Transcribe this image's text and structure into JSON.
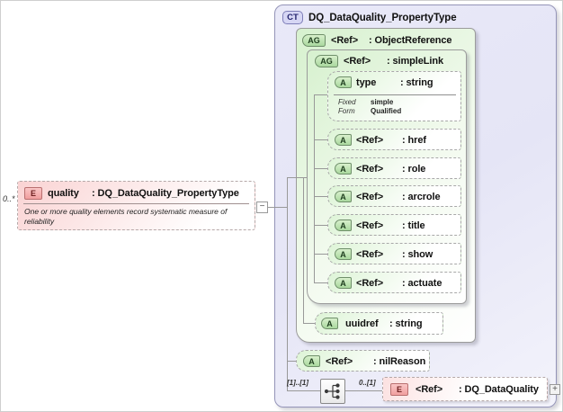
{
  "colors": {
    "line": "#999999",
    "ct-border": "#9494b8",
    "ct-badge-fill": "#d6d6f4",
    "ct-badge-border": "#7e7eb8",
    "ct-badge-text": "#24246e",
    "group-fill-a": "#d7f1cf",
    "group-border": "#9b9b9b",
    "capsule-border": "#a8a8a8",
    "capsule-fill": "#ddf4d6",
    "badge-green-a": "#d8f0cc",
    "badge-green-b": "#a9d89e",
    "badge-green-border": "#6f8f6a",
    "badge-green-text": "#1e3d1e",
    "e-badge-border": "#b97070",
    "e-badge-text": "#6e1f1f",
    "pink-fill-a": "#fad3d3"
  },
  "element": {
    "cardinality": "0..*",
    "badge": "E",
    "name": "quality",
    "type": ": DQ_DataQuality_PropertyType",
    "annotation": "One or more quality elements record systematic measure of reliability",
    "collapse": "−"
  },
  "complex_type": {
    "badge": "CT",
    "title": "DQ_DataQuality_PropertyType",
    "object_reference": {
      "badge": "AG",
      "name": "<Ref>",
      "type": ": ObjectReference"
    },
    "simple_link": {
      "badge": "AG",
      "name": "<Ref>",
      "type": ": simpleLink"
    },
    "type_attribute": {
      "badge": "A",
      "name": "type",
      "type": ": string",
      "facets": [
        {
          "label": "Fixed",
          "value": "simple"
        },
        {
          "label": "Form",
          "value": "Qualified"
        }
      ]
    },
    "attributes": [
      {
        "badge": "A",
        "name": "<Ref>",
        "type": ": href"
      },
      {
        "badge": "A",
        "name": "<Ref>",
        "type": ": role"
      },
      {
        "badge": "A",
        "name": "<Ref>",
        "type": ": arcrole"
      },
      {
        "badge": "A",
        "name": "<Ref>",
        "type": ": title"
      },
      {
        "badge": "A",
        "name": "<Ref>",
        "type": ": show"
      },
      {
        "badge": "A",
        "name": "<Ref>",
        "type": ": actuate"
      }
    ],
    "uuidref": {
      "badge": "A",
      "name": "uuidref",
      "type": ": string"
    },
    "nil_reason": {
      "badge": "A",
      "name": "<Ref>",
      "type": ": nilReason"
    },
    "choice": {
      "left_cardinality": "[1]..[1]",
      "right_cardinality": "0..[1]"
    },
    "dq_element": {
      "badge": "E",
      "name": "<Ref>",
      "type": ": DQ_DataQuality",
      "expand": "+"
    }
  }
}
